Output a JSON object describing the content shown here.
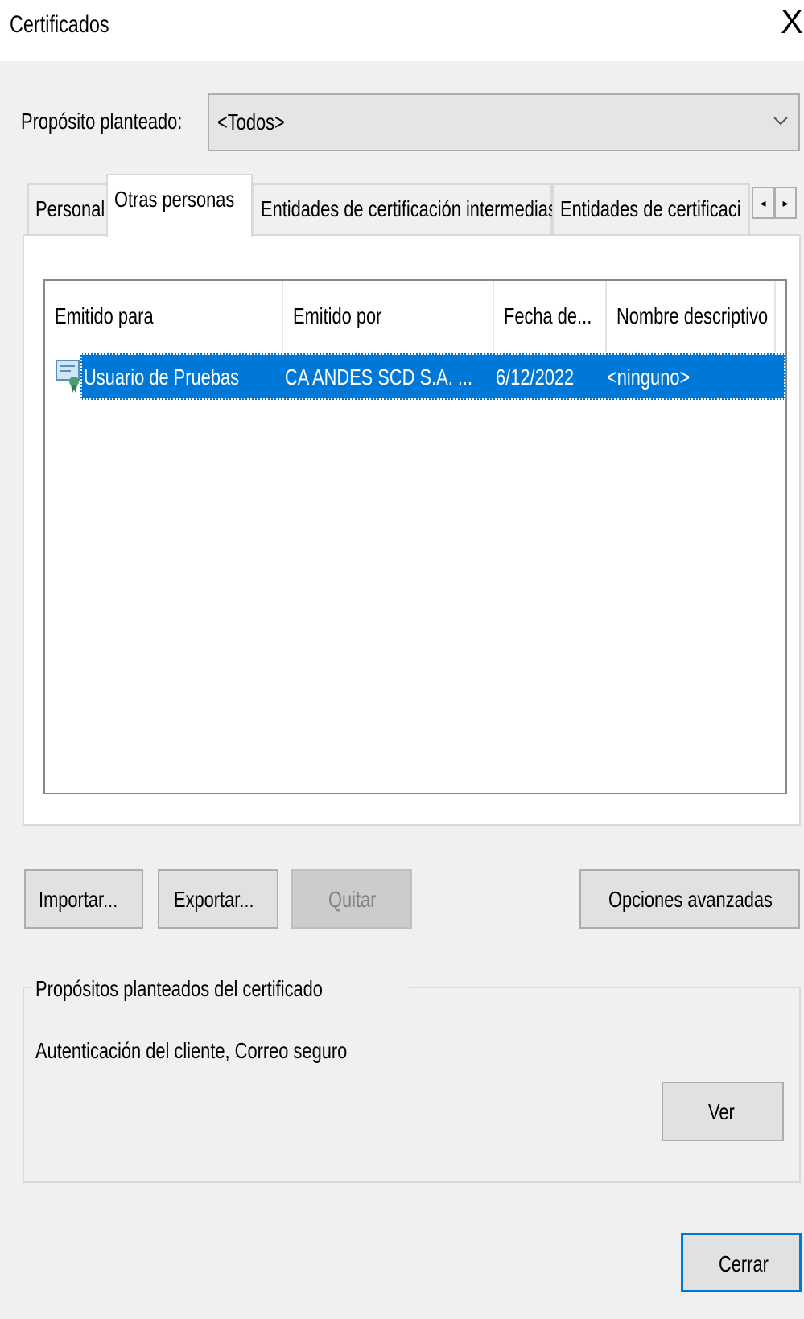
{
  "window": {
    "title": "Certificados",
    "close_glyph": "X"
  },
  "purpose": {
    "label": "Propósito planteado:",
    "value": "<Todos>"
  },
  "tabs": [
    {
      "label": "Personal",
      "active": false
    },
    {
      "label": "Otras personas",
      "active": true
    },
    {
      "label": "Entidades de certificación intermedias",
      "active": false
    },
    {
      "label": "Entidades de certificaci",
      "active": false
    }
  ],
  "list": {
    "columns": [
      "Emitido para",
      "Emitido por",
      "Fecha de...",
      "Nombre descriptivo"
    ],
    "rows": [
      {
        "issued_to": "Usuario de Pruebas",
        "issued_by": "CA ANDES SCD S.A. ...",
        "date": "6/12/2022",
        "friendly_name": "<ninguno>",
        "selected": true
      }
    ]
  },
  "buttons": {
    "import": "Importar...",
    "export": "Exportar...",
    "remove": "Quitar",
    "advanced": "Opciones avanzadas",
    "view": "Ver",
    "close": "Cerrar"
  },
  "purposes_group": {
    "title": "Propósitos planteados del certificado",
    "value": "Autenticación del cliente, Correo seguro"
  },
  "colors": {
    "selection": "#0078d7",
    "background": "#f0f0f0"
  }
}
